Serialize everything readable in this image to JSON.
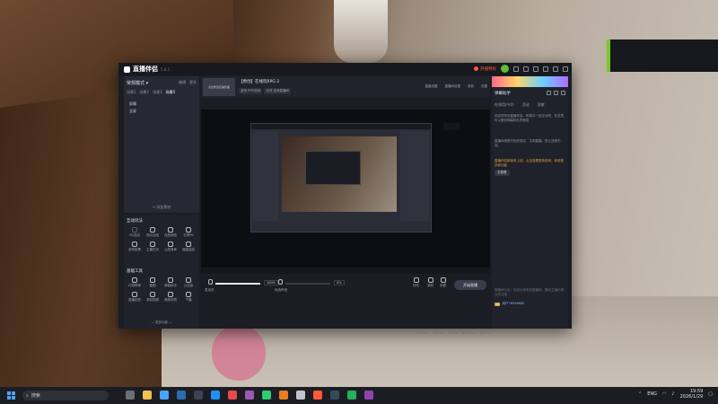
{
  "window": {
    "app_name": "直播伴侣",
    "version": "5.8.1",
    "live_badge": "开播特权",
    "live_badge_count": "new"
  },
  "left_panel": {
    "mode_label": "常规模式 ▾",
    "mode_actions": [
      "编辑",
      "更多"
    ],
    "scene_tabs": [
      "场景1",
      "场景2",
      "场景3",
      "场景4",
      "场景5"
    ],
    "active_scene_tab": "场景5",
    "sources": [
      "屏幕",
      "全屏"
    ],
    "add_source": "+ 添加素材",
    "interaction_title": "互动玩法",
    "interaction_tools": [
      "PK连线",
      "观众连线",
      "连线调查",
      "礼物PK",
      "游戏投票",
      "主播任务",
      "心愿清单",
      "福袋抽奖"
    ],
    "tools_title": "基础工具",
    "basic_tools": [
      "礼物榜单",
      "截图",
      "弹幕助手",
      "公告板",
      "直播回放",
      "录制视频",
      "美颜滤镜",
      "下播"
    ],
    "more_label": "— 更多功能 —"
  },
  "room": {
    "thumb_text": "点击修改直播封面",
    "title": "【原创】在线玩RPG 2",
    "tags": [
      "游戏 RPG游戏",
      "在线 游戏直播间"
    ],
    "actions": [
      "直播设置",
      "直播间设置",
      "音效",
      "设置"
    ]
  },
  "controls": {
    "volume_label": "麦克风",
    "volume_value": "100%",
    "monitor_label": "系统声音",
    "monitor_value": "0%",
    "icons": [
      "特效",
      "录制",
      "设置"
    ],
    "go_live": "开始直播"
  },
  "status_bar": [
    "CPU 20%",
    "内存 54%",
    "帧率 30",
    "码率 0kbps",
    "丢帧 0%"
  ],
  "right_panel": {
    "title": "弹幕助手",
    "tabs": [
      "在线用户(0)",
      "活动",
      "贡献"
    ],
    "msg1": "欢迎您来到直播伴侣，和观众一起互动吧，在这里可以看到弹幕和礼物信息",
    "msg2": "直播间请遵守相关规定，文明直播，禁止违规内容。",
    "notice": "直播伴侣新版本上线，点击查看更新说明，体验更多新功能",
    "notice_btn": "去看看",
    "footer": "直播间公告：欢迎大家来到直播间，喜欢主播记得点关注哦",
    "user_level": "12",
    "user_name": "用户78596685"
  },
  "taskbar": {
    "search_placeholder": "搜索",
    "lang": "ENG",
    "time": "19:59",
    "date": "2026/1/29"
  },
  "colors": {
    "accent_live": "#ff5a3c",
    "notice": "#e09b3d",
    "win_blue": "#4aa3ff"
  }
}
